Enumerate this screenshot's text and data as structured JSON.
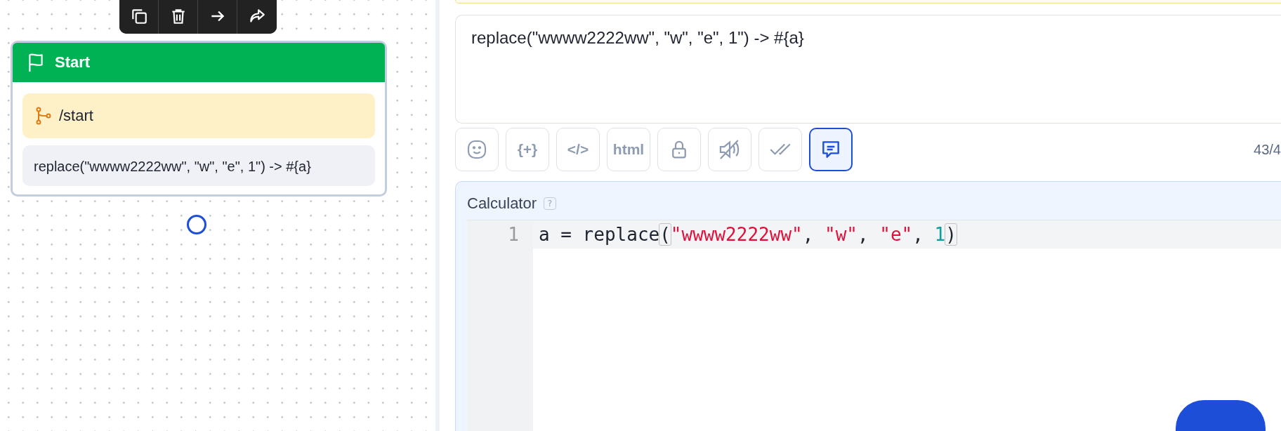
{
  "node_toolbar": [
    {
      "kind": "copy"
    },
    {
      "kind": "delete"
    },
    {
      "kind": "arrow"
    },
    {
      "kind": "forward"
    }
  ],
  "node": {
    "title": "Start",
    "trigger": "/start",
    "message": "replace(\"wwww2222ww\", \"w\", \"e\", 1\") -> #{a}",
    "selected": true
  },
  "editor": {
    "value": "replace(\"wwww2222ww\", \"w\", \"e\", 1\") -> #{a}",
    "counter": "43/4"
  },
  "editor_tools": [
    {
      "kind": "emoji",
      "selected": false
    },
    {
      "kind": "text",
      "label": "{+}",
      "selected": false
    },
    {
      "kind": "text",
      "label": "</>",
      "selected": false
    },
    {
      "kind": "text",
      "label": "html",
      "selected": false
    },
    {
      "kind": "lock",
      "selected": false
    },
    {
      "kind": "mute",
      "selected": false
    },
    {
      "kind": "checks",
      "selected": false
    },
    {
      "kind": "comment",
      "selected": true
    }
  ],
  "calculator": {
    "title": "Calculator",
    "help": "?",
    "lines": [
      {
        "number": "1",
        "tokens": [
          {
            "kind": "plain",
            "text": "a = replace"
          },
          {
            "kind": "bracket",
            "text": "("
          },
          {
            "kind": "string",
            "text": "\"wwww2222ww\""
          },
          {
            "kind": "plain",
            "text": ", "
          },
          {
            "kind": "string",
            "text": "\"w\""
          },
          {
            "kind": "plain",
            "text": ", "
          },
          {
            "kind": "string",
            "text": "\"e\""
          },
          {
            "kind": "plain",
            "text": ", "
          },
          {
            "kind": "number",
            "text": "1"
          },
          {
            "kind": "bracket",
            "text": ")"
          }
        ]
      }
    ]
  }
}
